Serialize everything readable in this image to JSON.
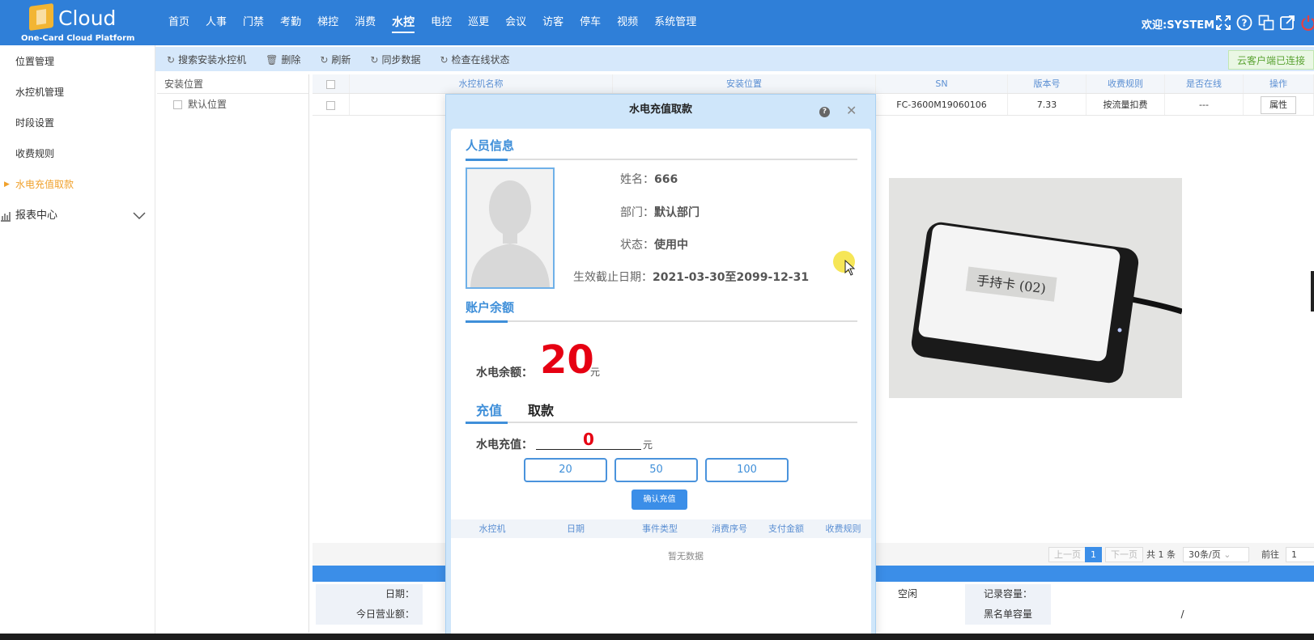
{
  "header": {
    "brand": "Cloud",
    "tagline": "One-Card Cloud Platform",
    "nav": [
      "首页",
      "人事",
      "门禁",
      "考勤",
      "梯控",
      "消费",
      "水控",
      "电控",
      "巡更",
      "会议",
      "访客",
      "停车",
      "视频",
      "系统管理"
    ],
    "active_nav": "水控",
    "welcome": "欢迎:SYSTEM"
  },
  "sidebar": {
    "items": [
      "位置管理",
      "水控机管理",
      "时段设置",
      "收费规则",
      "水电充值取款"
    ],
    "active": "水电充值取款",
    "group": "报表中心"
  },
  "toolbar": {
    "buttons": [
      "搜索安装水控机",
      "删除",
      "刷新",
      "同步数据",
      "检查在线状态"
    ],
    "cloud_status": "云客户端已连接"
  },
  "location_panel": {
    "header": "安装位置",
    "node": "默认位置"
  },
  "grid": {
    "columns": [
      "水控机名称",
      "安装位置",
      "SN",
      "版本号",
      "收费规则",
      "是否在线",
      "操作"
    ],
    "rows": [
      {
        "name": "",
        "location": "",
        "sn": "FC-3600M19060106",
        "version": "7.33",
        "rule": "按流量扣费",
        "online": "---",
        "action": "属性"
      }
    ]
  },
  "pager": {
    "prev": "上一页",
    "current": "1",
    "next": "下一页",
    "total": "共 1 条",
    "page_size": "30条/页",
    "goto_label": "前往",
    "goto_value": "1"
  },
  "info": {
    "date_label": "日期：",
    "revenue_label": "今日营业额：",
    "status_value": "空闲",
    "record_capacity_label": "记录容量：",
    "blacklist_capacity_label": "黑名单容量",
    "blacklist_capacity_value": "/"
  },
  "reader_card_text": "手持卡 (02)",
  "modal": {
    "title": "水电充值取款",
    "section_person": "人员信息",
    "name_label": "姓名：",
    "name_value": "666",
    "dept_label": "部门：",
    "dept_value": "默认部门",
    "status_label": "状态：",
    "status_value": "使用中",
    "validity_label": "生效截止日期：",
    "validity_value": "2021-03-30至2099-12-31",
    "section_balance": "账户余额",
    "balance_label": "水电余额：",
    "balance_value": "20",
    "balance_unit": "元",
    "tab_recharge": "充值",
    "tab_withdraw": "取款",
    "recharge_label": "水电充值：",
    "recharge_value": "0",
    "recharge_unit": "元",
    "amounts": [
      "20",
      "50",
      "100"
    ],
    "confirm": "确认充值",
    "record_columns": [
      "水控机",
      "日期",
      "事件类型",
      "消费序号",
      "支付金额",
      "收费规则"
    ],
    "no_data": "暂无数据"
  },
  "colors": {
    "primary": "#2f7fd8",
    "accent": "#3f8fd9",
    "balance_red": "#e60012",
    "active_menu": "#f0a12c"
  }
}
